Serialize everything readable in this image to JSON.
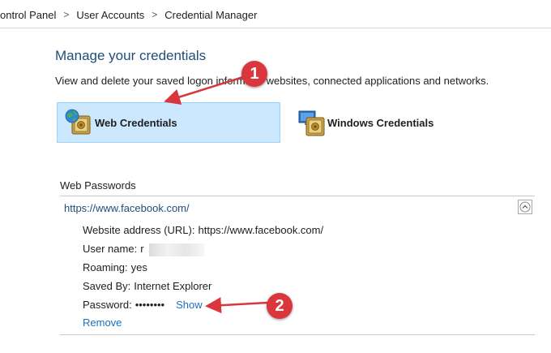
{
  "breadcrumb": {
    "items": [
      "ontrol Panel",
      "User Accounts",
      "Credential Manager"
    ],
    "separator": ">"
  },
  "main": {
    "title": "Manage your credentials",
    "subtitle": "View and delete your saved logon informa      or websites, connected applications and networks."
  },
  "tabs": [
    {
      "label": "Web Credentials",
      "selected": true,
      "icon": "web-credentials-icon"
    },
    {
      "label": "Windows Credentials",
      "selected": false,
      "icon": "windows-credentials-icon"
    }
  ],
  "web_passwords": {
    "header": "Web Passwords",
    "entry": {
      "url": "https://www.facebook.com/",
      "website_label": "Website address (URL):",
      "website_value": "https://www.facebook.com/",
      "username_label": "User name:",
      "username_value": "r",
      "roaming_label": "Roaming:",
      "roaming_value": "yes",
      "saved_by_label": "Saved By:",
      "saved_by_value": "Internet Explorer",
      "password_label": "Password:",
      "password_value": "••••••••",
      "show_label": "Show",
      "remove_label": "Remove"
    }
  },
  "annotations": [
    "1",
    "2"
  ],
  "colors": {
    "selected_tab_bg": "#cce8ff",
    "title_blue": "#1f4e79",
    "link_blue": "#1a6fc0",
    "callout_red": "#d9363e"
  }
}
